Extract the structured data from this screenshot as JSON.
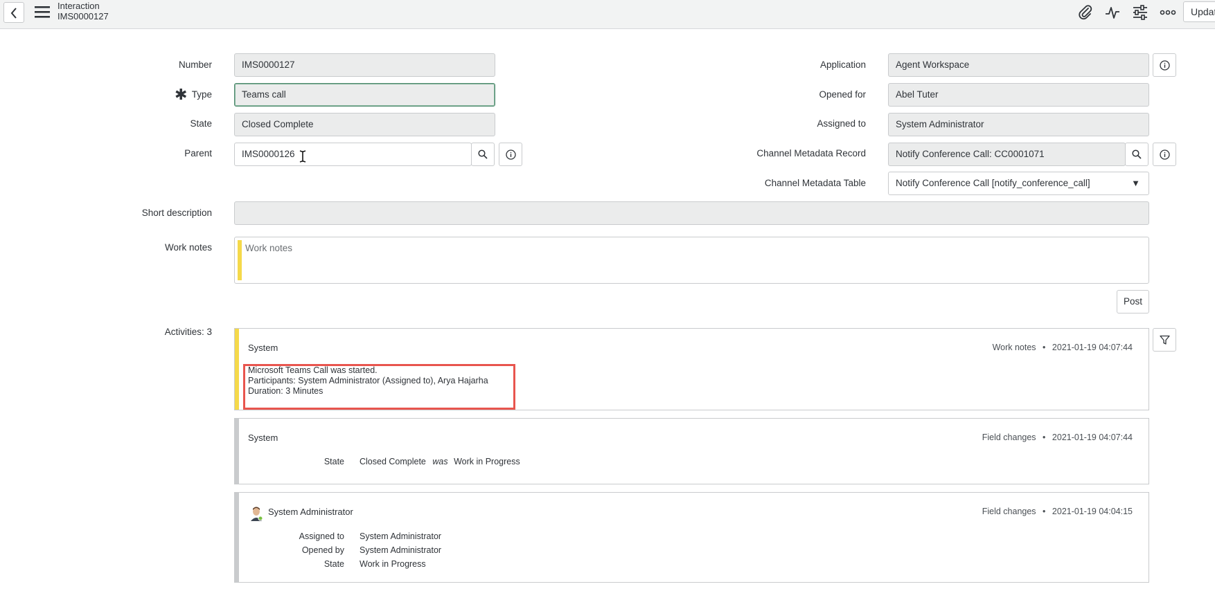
{
  "header": {
    "title": "Interaction",
    "subtitle": "IMS0000127",
    "update_label": "Updat",
    "icons": [
      "back-icon",
      "menu-icon",
      "paperclip-icon",
      "activity-icon",
      "settings-sliders-icon",
      "more-icon"
    ]
  },
  "form": {
    "number": {
      "label": "Number",
      "value": "IMS0000127"
    },
    "type": {
      "label": "Type",
      "value": "Teams call",
      "required_mark": "✱"
    },
    "state": {
      "label": "State",
      "value": "Closed Complete"
    },
    "parent": {
      "label": "Parent",
      "value": "IMS0000126"
    },
    "application": {
      "label": "Application",
      "value": "Agent Workspace"
    },
    "opened_for": {
      "label": "Opened for",
      "value": "Abel Tuter"
    },
    "assigned_to": {
      "label": "Assigned to",
      "value": "System Administrator"
    },
    "channel_record": {
      "label": "Channel Metadata Record",
      "value": "Notify Conference Call: CC0001071"
    },
    "channel_table": {
      "label": "Channel Metadata Table",
      "value": "Notify Conference Call [notify_conference_call]",
      "caret": "▼"
    },
    "short_description": {
      "label": "Short description",
      "value": ""
    },
    "work_notes": {
      "label": "Work notes",
      "placeholder": "Work notes"
    },
    "post_label": "Post"
  },
  "activities": {
    "label": "Activities: 3",
    "separator": "•",
    "cards": [
      {
        "author": "System",
        "type": "Work notes",
        "timestamp": "2021-01-19 04:07:44",
        "lines": [
          "Microsoft Teams Call was started.",
          "Participants: System Administrator (Assigned to), Arya Hajarha",
          "Duration: 3 Minutes"
        ]
      },
      {
        "author": "System",
        "type": "Field changes",
        "timestamp": "2021-01-19 04:07:44",
        "changes": [
          {
            "field": "State",
            "new": "Closed Complete",
            "was_word": "was",
            "old": "Work in Progress"
          }
        ]
      },
      {
        "author": "System Administrator",
        "type": "Field changes",
        "timestamp": "2021-01-19 04:04:15",
        "changes": [
          {
            "field": "Assigned to",
            "new": "System Administrator"
          },
          {
            "field": "Opened by",
            "new": "System Administrator"
          },
          {
            "field": "State",
            "new": "Work in Progress"
          }
        ]
      }
    ]
  },
  "colors": {
    "work_note_bar": "#f5d94a",
    "field_change_bar": "#c9cbcd",
    "highlight_box": "#e8554e",
    "focus_border": "#4f8a6f"
  }
}
